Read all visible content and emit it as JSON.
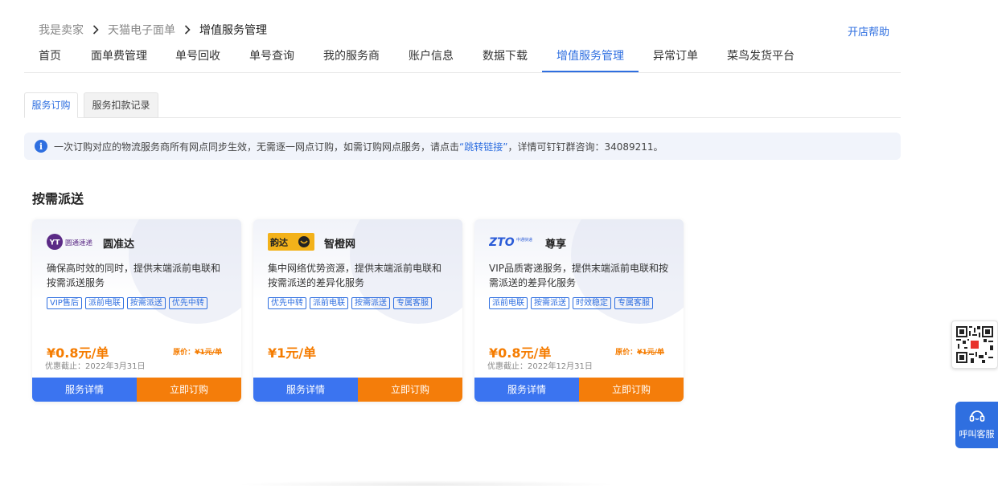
{
  "breadcrumb": {
    "items": [
      "我是卖家",
      "天猫电子面单",
      "增值服务管理"
    ]
  },
  "help_link": "开店帮助",
  "nav": {
    "tabs": [
      {
        "label": "首页"
      },
      {
        "label": "面单费管理"
      },
      {
        "label": "单号回收"
      },
      {
        "label": "单号查询"
      },
      {
        "label": "我的服务商"
      },
      {
        "label": "账户信息"
      },
      {
        "label": "数据下载"
      },
      {
        "label": "增值服务管理",
        "active": true
      },
      {
        "label": "异常订单"
      },
      {
        "label": "菜鸟发货平台"
      }
    ]
  },
  "subtabs": [
    "服务订购",
    "服务扣款记录"
  ],
  "notice": {
    "prefix": "一次订购对应的物流服务商所有网点同步生效，无需逐一网点订购，如需订购网点服务，请点击",
    "link": "“跳转链接”",
    "suffix": "，详情可钉钉群咨询：34089211。"
  },
  "section_title": "按需派送",
  "cards": [
    {
      "name": "圆准达",
      "logo_text": "圆通速递",
      "desc": "确保高时效的同时，提供末端派前电联和按需派送服务",
      "tags": [
        "VIP售后",
        "派前电联",
        "按需派送",
        "优先中转"
      ],
      "price": "¥0.8元/单",
      "orig_label": "原价：",
      "orig_price": "¥1元/单",
      "deadline": "优惠截止：2022年3月31日",
      "detail_btn": "服务详情",
      "order_btn": "立即订购"
    },
    {
      "name": "智橙网",
      "logo_text": "韵达",
      "desc": "集中网络优势资源，提供末端派前电联和按需派送的差异化服务",
      "tags": [
        "优先中转",
        "派前电联",
        "按需派送",
        "专属客服"
      ],
      "price": "¥1元/单",
      "detail_btn": "服务详情",
      "order_btn": "立即订购"
    },
    {
      "name": "尊享",
      "logo_text": "ZTO 中通快递",
      "desc": "VIP品质寄递服务，提供末端派前电联和按需派送的差异化服务",
      "tags": [
        "派前电联",
        "按需派送",
        "时效稳定",
        "专属客服"
      ],
      "price": "¥0.8元/单",
      "orig_label": "原价：",
      "orig_price": "¥1元/单",
      "deadline": "优惠截止：2022年12月31日",
      "detail_btn": "服务详情",
      "order_btn": "立即订购"
    }
  ],
  "customer_service": {
    "label": "呼叫客服"
  },
  "colors": {
    "accent": "#2f6fe0",
    "order_button": "#f47d0a",
    "detail_button": "#3b74f0",
    "price": "#f57c00"
  }
}
